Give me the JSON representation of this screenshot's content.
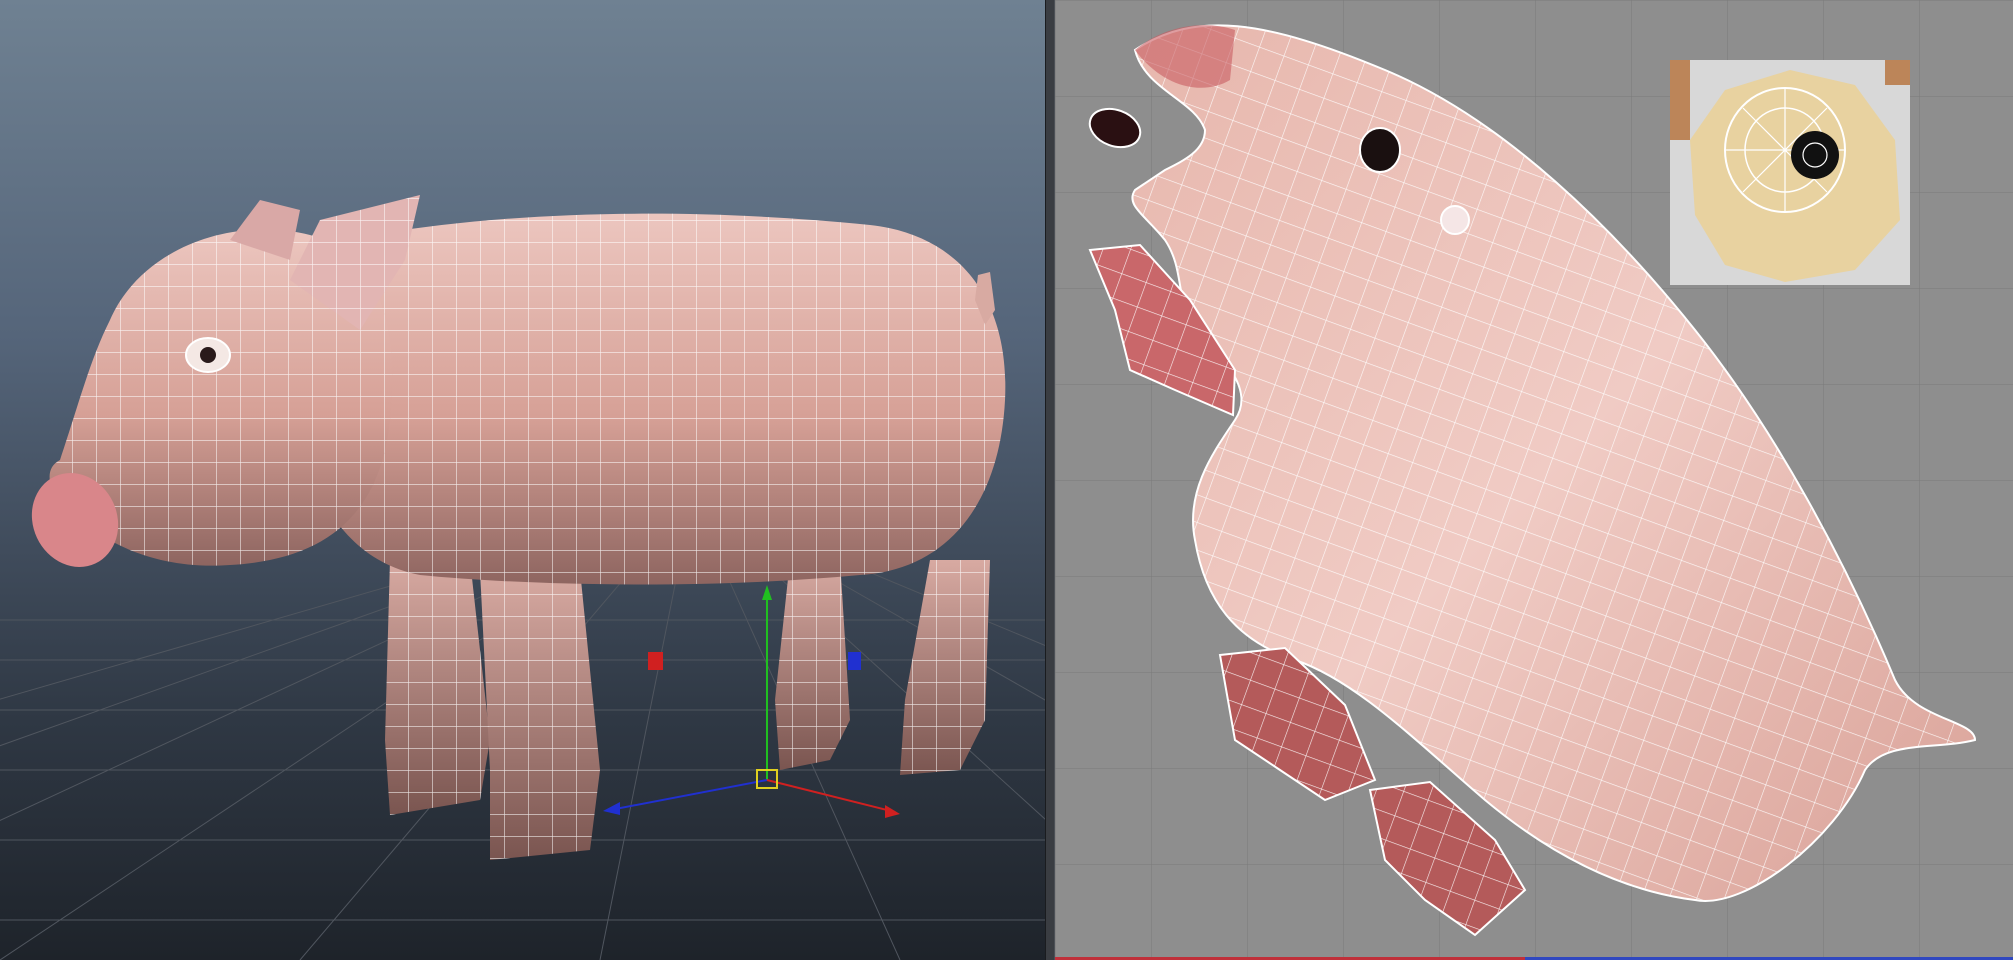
{
  "app": {
    "left_panel": "3d-perspective-viewport",
    "right_panel": "uv-texture-editor"
  },
  "viewport": {
    "background_top": "#6f8192",
    "background_bottom": "#1e232a",
    "grid_color": "#50565f",
    "model_color": "#d9a69c",
    "wire_color": "#ffffff",
    "manipulator": {
      "x_axis_color": "#d02020",
      "y_axis_color": "#20c020",
      "z_axis_color": "#2030d0",
      "center_color": "#e0d020"
    }
  },
  "uv_editor": {
    "background": "#8e8e8e",
    "grid_color": "#7a7a7a",
    "texture_swatch_bg": "#d8d8d8",
    "eye_texture_color": "#e8d2a0"
  }
}
